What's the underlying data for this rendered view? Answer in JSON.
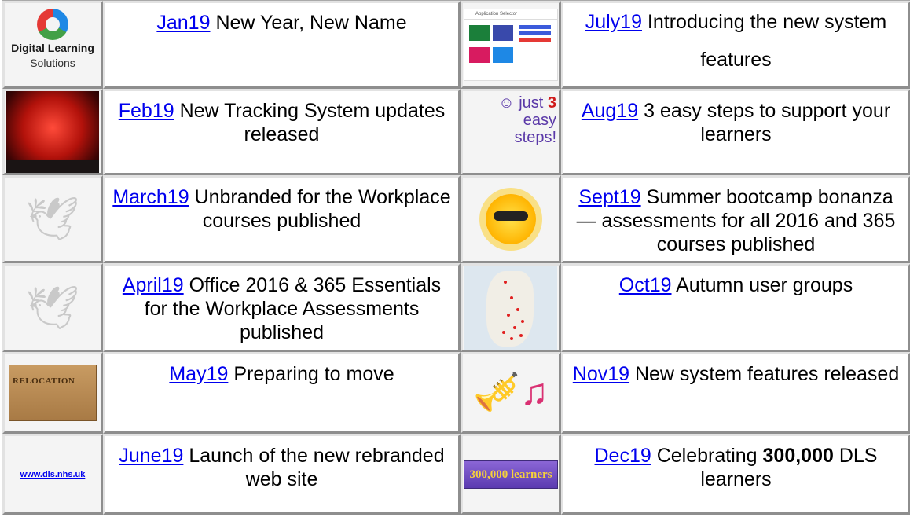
{
  "logo": {
    "title": "Digital Learning",
    "subtitle": "Solutions"
  },
  "app_thumb": {
    "title": "Application Selector"
  },
  "stick_thumb": {
    "line1": "just",
    "number": "3",
    "line2": "easy",
    "line3": "steps!"
  },
  "box_thumb": {
    "label": "RELOCATION"
  },
  "url_thumb": {
    "text": "www.dls.nhs.uk"
  },
  "learners_thumb": {
    "text": "300,000 learners"
  },
  "entries": [
    {
      "link": "Jan19",
      "text": " New Year, New Name"
    },
    {
      "link": "July19",
      "text": " Introducing the new system features"
    },
    {
      "link": "Feb19",
      "text": " New Tracking System updates released"
    },
    {
      "link": "Aug19",
      "text": " 3 easy steps to support your learners"
    },
    {
      "link": "March19",
      "text": " Unbranded for the Workplace courses published"
    },
    {
      "link": "Sept19",
      "text": " Summer bootcamp bonanza — assessments for all 2016 and 365 courses published"
    },
    {
      "link": "April19",
      "text": " Office 2016 & 365 Essentials for the Workplace Assessments published"
    },
    {
      "link": "Oct19",
      "text": " Autumn user groups"
    },
    {
      "link": "May19",
      "text": " Preparing to move"
    },
    {
      "link": "Nov19",
      "text": " New system features released"
    },
    {
      "link": "June19",
      "text": " Launch of the new rebranded web site"
    },
    {
      "link": "Dec19",
      "pre": " Celebrating ",
      "bold": "300,000",
      "post": " DLS learners"
    }
  ]
}
